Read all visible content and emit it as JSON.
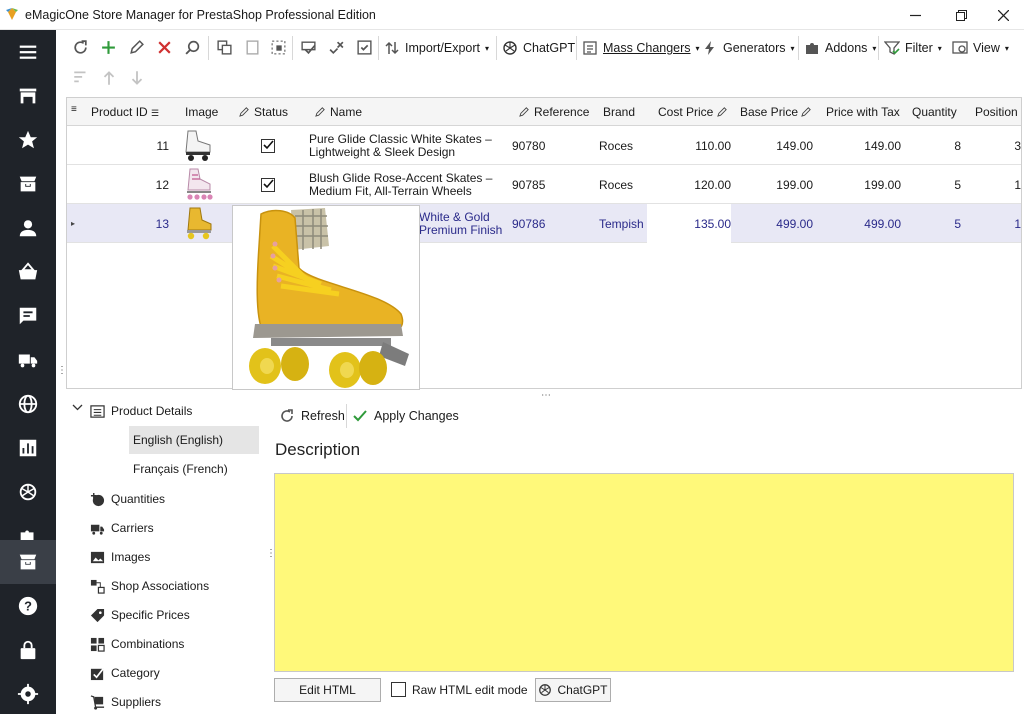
{
  "window": {
    "title": "eMagicOne Store Manager for PrestaShop Professional Edition",
    "controls": [
      "minimize-icon",
      "restore-icon",
      "close-icon"
    ]
  },
  "sidebar": {
    "items": [
      {
        "icon": "hamburger-menu-icon"
      },
      {
        "icon": "store-icon"
      },
      {
        "icon": "star-icon"
      },
      {
        "icon": "box-icon"
      },
      {
        "icon": "user-icon"
      },
      {
        "icon": "basket-icon"
      },
      {
        "icon": "message-icon"
      },
      {
        "icon": "truck-icon"
      },
      {
        "icon": "globe-icon"
      },
      {
        "icon": "chart-icon"
      },
      {
        "icon": "openai-icon"
      },
      {
        "icon": "puzzle-icon"
      },
      {
        "icon": "archive-icon",
        "active": true
      },
      {
        "icon": "help-icon"
      },
      {
        "icon": "lock-icon"
      },
      {
        "icon": "settings-icon"
      }
    ]
  },
  "toolbar": {
    "import_export": "Import/Export",
    "chatgpt": "ChatGPT",
    "mass_changers": "Mass Changers",
    "generators": "Generators",
    "addons": "Addons",
    "filter": "Filter",
    "view": "View"
  },
  "grid": {
    "columns": [
      "Product ID",
      "Image",
      "Status",
      "Name",
      "Reference",
      "Brand",
      "Cost Price",
      "Base Price",
      "Price with Tax",
      "Quantity",
      "Position"
    ],
    "rows": [
      {
        "id": "11",
        "status": true,
        "name": "Pure Glide Classic White Skates – Lightweight & Sleek Design",
        "reference": "90780",
        "brand": "Roces",
        "cost": "110.00",
        "base": "149.00",
        "tax": "149.00",
        "qty": "8",
        "pos": "3"
      },
      {
        "id": "12",
        "status": true,
        "name": "Blush Glide Rose-Accent Skates – Medium Fit, All-Terrain Wheels",
        "reference": "90785",
        "brand": "Roces",
        "cost": "120.00",
        "base": "199.00",
        "tax": "199.00",
        "qty": "5",
        "pos": "1"
      },
      {
        "id": "13",
        "status": true,
        "name": "White & Gold Premium Finish",
        "reference": "90786",
        "brand": "Tempish",
        "cost": "135.00",
        "base": "499.00",
        "tax": "499.00",
        "qty": "5",
        "pos": "1"
      }
    ]
  },
  "tree": {
    "product_details": "Product Details",
    "languages": [
      "English (English)",
      "Français (French)"
    ],
    "items": [
      "Quantities",
      "Carriers",
      "Images",
      "Shop Associations",
      "Specific Prices",
      "Combinations",
      "Category",
      "Suppliers"
    ]
  },
  "panel": {
    "refresh": "Refresh",
    "apply": "Apply Changes",
    "description_title": "Description",
    "edit_html": "Edit HTML",
    "raw_mode": "Raw HTML edit mode",
    "chatgpt": "ChatGPT",
    "editor_color": "#fff97a"
  },
  "colors": {
    "sidebar_bg": "#1f2329",
    "selected_row": "#e8e8f5",
    "selected_text": "#2a2a8a"
  }
}
